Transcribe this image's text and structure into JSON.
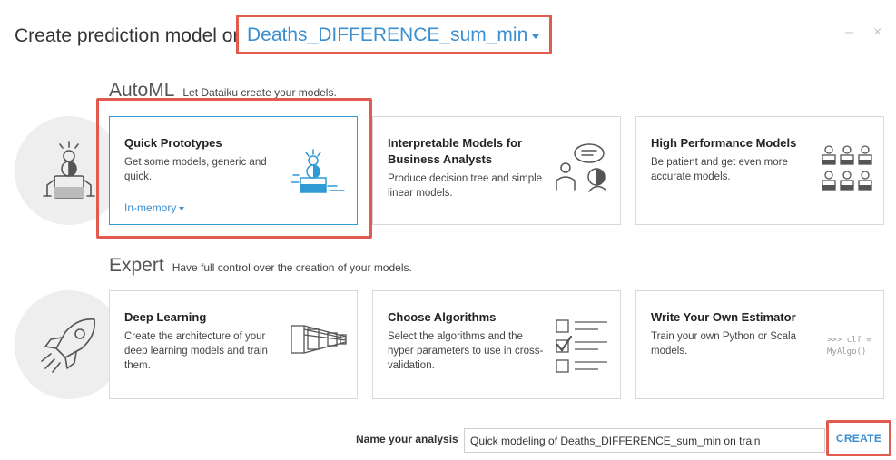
{
  "header": {
    "title": "Create prediction model on",
    "target": "Deaths_DIFFERENCE_sum_min",
    "minimize": "–",
    "close": "×"
  },
  "automl": {
    "title": "AutoML",
    "subtitle": "Let Dataiku create your models.",
    "cards": [
      {
        "title": "Quick Prototypes",
        "description": "Get some models, generic and quick.",
        "engine": "In-memory"
      },
      {
        "title": "Interpretable Models for Business Analysts",
        "description": "Produce decision tree and simple linear models."
      },
      {
        "title": "High Performance Models",
        "description": "Be patient and get even more accurate models."
      }
    ]
  },
  "expert": {
    "title": "Expert",
    "subtitle": "Have full control over the creation of your models.",
    "cards": [
      {
        "title": "Deep Learning",
        "description": "Create the architecture of your deep learning models and train them."
      },
      {
        "title": "Choose Algorithms",
        "description": "Select the algorithms and the hyper parameters to use in cross-validation."
      },
      {
        "title": "Write Your Own Estimator",
        "description": "Train your own Python or Scala models.",
        "code_line1": ">>> clf =",
        "code_line2": "MyAlgo()"
      }
    ]
  },
  "footer": {
    "name_label": "Name your analysis",
    "name_value": "Quick modeling of Deaths_DIFFERENCE_sum_min on train",
    "create_label": "CREATE"
  },
  "colors": {
    "accent": "#3a8fd0",
    "highlight": "#e25b50",
    "selected_border": "#2f9ad6"
  }
}
